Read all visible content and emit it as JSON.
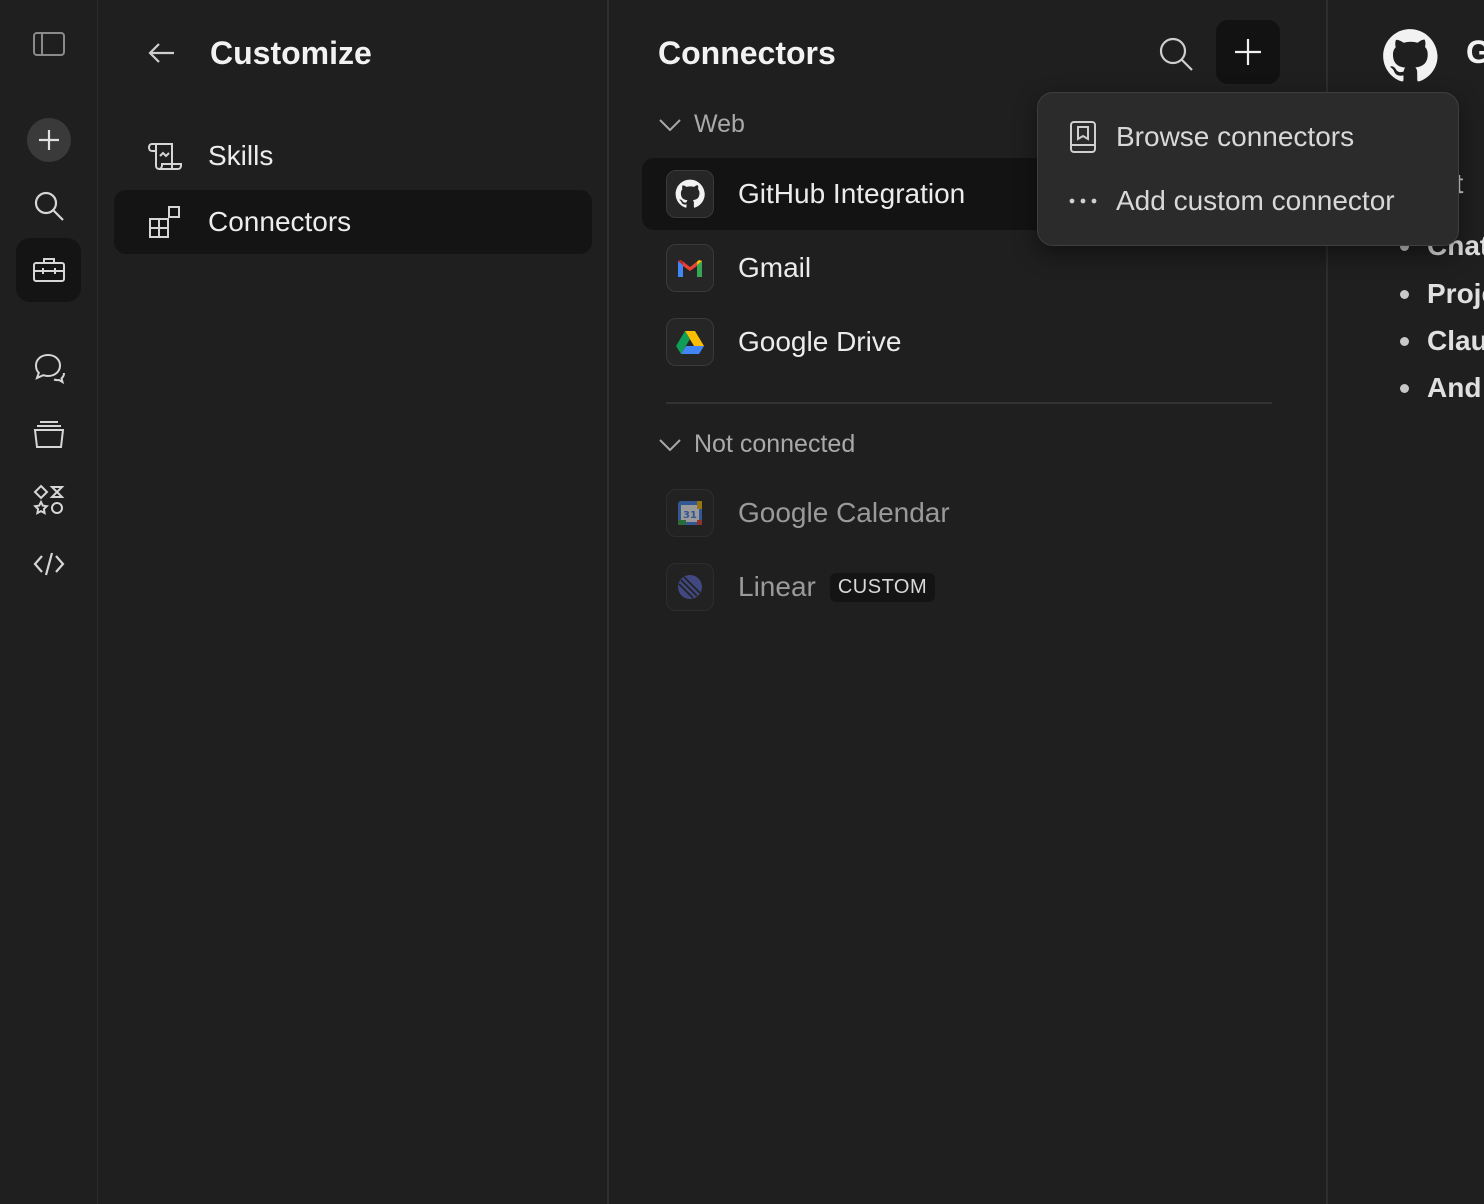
{
  "rail": {
    "items": [
      {
        "name": "toggle-sidebar",
        "icon": "sidebar-icon"
      },
      {
        "name": "new-chat",
        "icon": "plus-icon"
      },
      {
        "name": "search",
        "icon": "search-icon"
      },
      {
        "name": "customize",
        "icon": "toolbox-icon",
        "active": true
      },
      {
        "name": "chats",
        "icon": "chat-bubbles-icon"
      },
      {
        "name": "projects",
        "icon": "stack-icon"
      },
      {
        "name": "artifacts",
        "icon": "shapes-icon"
      },
      {
        "name": "code",
        "icon": "code-icon"
      }
    ]
  },
  "customize": {
    "title": "Customize",
    "nav": [
      {
        "label": "Skills",
        "icon": "scroll-icon"
      },
      {
        "label": "Connectors",
        "icon": "blocks-icon",
        "active": true
      }
    ]
  },
  "connectors": {
    "title": "Connectors",
    "sections": [
      {
        "label": "Web",
        "items": [
          {
            "label": "GitHub Integration",
            "icon": "github-icon",
            "active": true
          },
          {
            "label": "Gmail",
            "icon": "gmail-icon"
          },
          {
            "label": "Google Drive",
            "icon": "google-drive-icon"
          }
        ]
      },
      {
        "label": "Not connected",
        "items": [
          {
            "label": "Google Calendar",
            "icon": "google-calendar-icon",
            "calendar_day": "31"
          },
          {
            "label": "Linear",
            "icon": "linear-icon",
            "badge": "CUSTOM"
          }
        ]
      }
    ]
  },
  "dropdown": {
    "items": [
      {
        "label": "Browse connectors",
        "icon": "book-icon"
      },
      {
        "label": "Add custom connector",
        "icon": "more-dots-icon"
      }
    ]
  },
  "detail": {
    "title": "G",
    "text_fragment": "ect",
    "bullets": [
      "Chat",
      "Proje",
      "Clau",
      "And"
    ]
  },
  "colors": {
    "background": "#1f1f1f",
    "active_row": "#141414",
    "dropdown": "#2b2b2b",
    "text": "#ececec",
    "muted_text": "#9a9a9a"
  }
}
